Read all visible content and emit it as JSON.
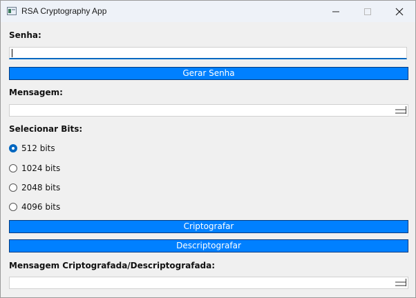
{
  "window": {
    "title": "RSA Cryptography App"
  },
  "form": {
    "senha_label": "Senha:",
    "senha_value": "",
    "gerar_senha_button": "Gerar Senha",
    "mensagem_label": "Mensagem:",
    "mensagem_value": "",
    "bits_label": "Selecionar Bits:",
    "bits_options": [
      {
        "label": "512 bits",
        "selected": true
      },
      {
        "label": "1024 bits",
        "selected": false
      },
      {
        "label": "2048 bits",
        "selected": false
      },
      {
        "label": "4096 bits",
        "selected": false
      }
    ],
    "criptografar_button": "Criptografar",
    "descriptografar_button": "Descriptografar",
    "resultado_label": "Mensagem Criptografada/Descriptografada:",
    "resultado_value": ""
  },
  "colors": {
    "button_bg": "#0080ff",
    "accent": "#0067c0"
  },
  "icons": {
    "app": "window-app-icon",
    "minimize": "minimize-icon",
    "maximize": "maximize-icon",
    "close": "close-icon"
  }
}
